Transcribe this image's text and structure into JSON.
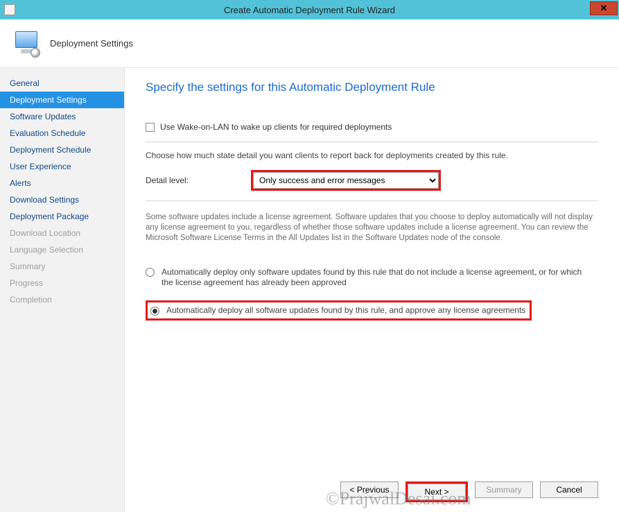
{
  "window": {
    "title": "Create Automatic Deployment Rule Wizard",
    "close_symbol": "✕"
  },
  "header": {
    "title": "Deployment Settings"
  },
  "sidebar": {
    "items": [
      {
        "label": "General",
        "state": "normal"
      },
      {
        "label": "Deployment Settings",
        "state": "active"
      },
      {
        "label": "Software Updates",
        "state": "normal"
      },
      {
        "label": "Evaluation Schedule",
        "state": "normal"
      },
      {
        "label": "Deployment Schedule",
        "state": "normal"
      },
      {
        "label": "User Experience",
        "state": "normal"
      },
      {
        "label": "Alerts",
        "state": "normal"
      },
      {
        "label": "Download Settings",
        "state": "normal"
      },
      {
        "label": "Deployment Package",
        "state": "normal"
      },
      {
        "label": "Download Location",
        "state": "disabled"
      },
      {
        "label": "Language Selection",
        "state": "disabled"
      },
      {
        "label": "Summary",
        "state": "disabled"
      },
      {
        "label": "Progress",
        "state": "disabled"
      },
      {
        "label": "Completion",
        "state": "disabled"
      }
    ]
  },
  "main": {
    "page_title": "Specify the settings for this Automatic Deployment Rule",
    "wol_checkbox_label": "Use Wake-on-LAN to wake up clients for required deployments",
    "wol_checked": false,
    "state_hint": "Choose how much state detail you want clients to report back for deployments created by this rule.",
    "detail_level_label": "Detail level:",
    "detail_level_value": "Only success and error messages",
    "license_note": "Some software updates include a license agreement. Software updates that you choose to deploy automatically will not display any license agreement to you, regardless of whether those software updates include a license agreement. You can review the Microsoft Software License Terms in the All Updates list in the Software Updates node of the console.",
    "radio_option_1": "Automatically deploy only software updates found by this rule that do not include a license agreement, or for which the license agreement has already been approved",
    "radio_option_2": "Automatically deploy all software updates found by this rule, and approve any license agreements",
    "selected_radio": 2
  },
  "footer": {
    "previous": "< Previous",
    "next": "Next >",
    "summary": "Summary",
    "cancel": "Cancel"
  },
  "watermark": "©PrajwalDesai.com"
}
